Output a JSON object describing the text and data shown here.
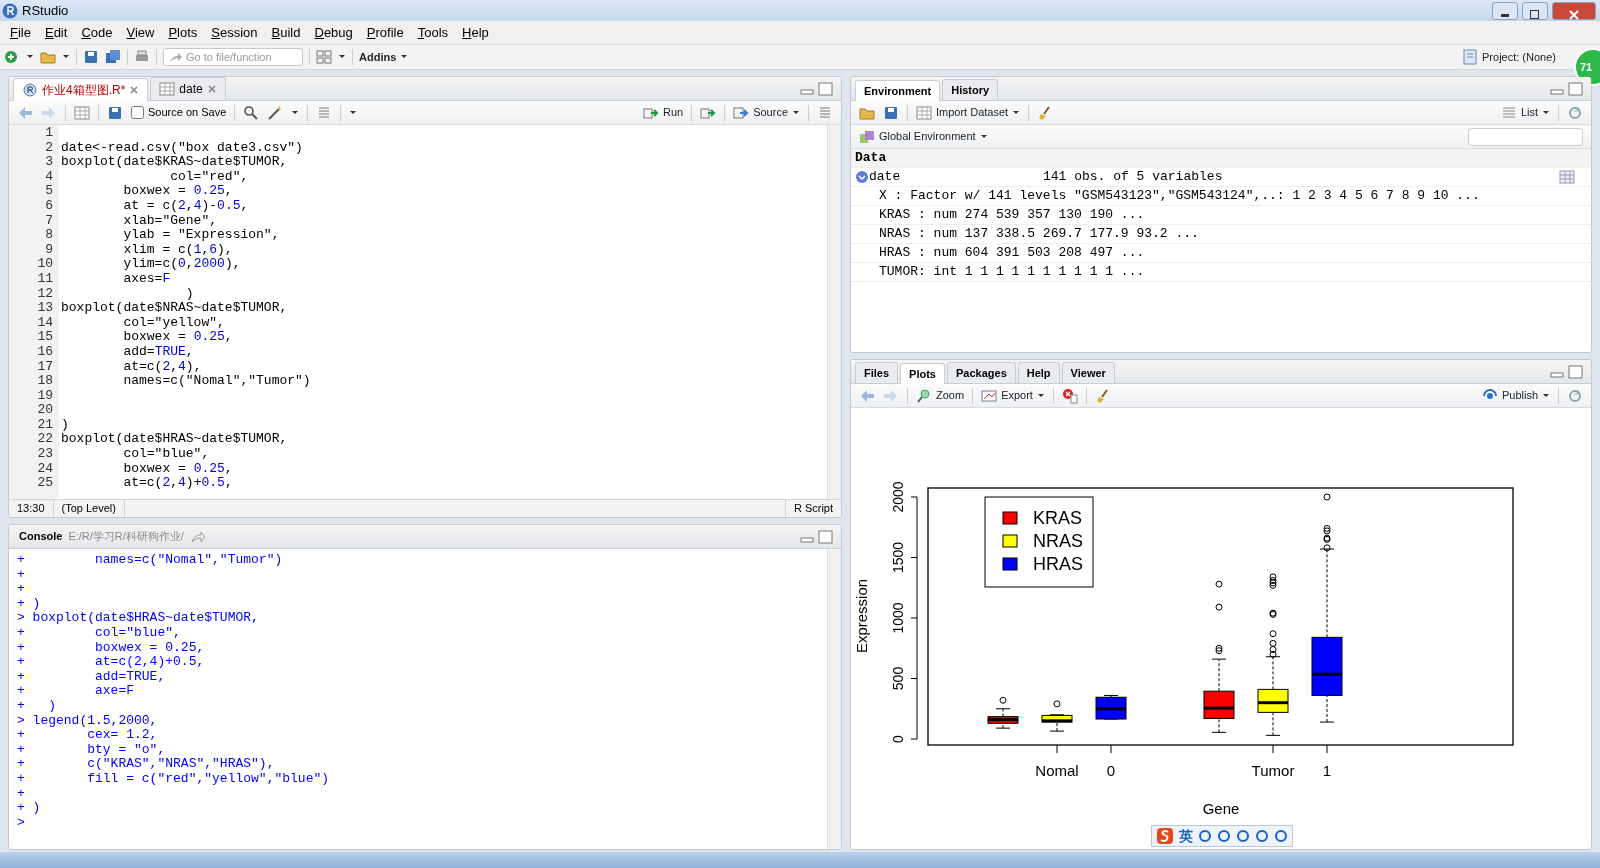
{
  "window": {
    "title": "RStudio"
  },
  "menu": [
    "File",
    "Edit",
    "Code",
    "View",
    "Plots",
    "Session",
    "Build",
    "Debug",
    "Profile",
    "Tools",
    "Help"
  ],
  "toolbar": {
    "goto_placeholder": "Go to file/function",
    "addins": "Addins",
    "project": "Project: (None)"
  },
  "notification_badge": "71",
  "editor": {
    "tabs": [
      {
        "label": "作业4箱型图.R*",
        "kind": "script",
        "unsaved": true,
        "selected": true
      },
      {
        "label": "date",
        "kind": "data",
        "unsaved": false,
        "selected": false
      }
    ],
    "source_on_save": {
      "label": "Source on Save",
      "checked": false
    },
    "run_label": "Run",
    "source_label": "Source",
    "lines": [
      {
        "number": "1"
      },
      {
        "number": "2",
        "text": "date<-read.csv(\"box date3.csv\")"
      },
      {
        "number": "3",
        "text": "boxplot(date$KRAS~date$TUMOR,"
      },
      {
        "number": "4",
        "text": "              col=\"red\","
      },
      {
        "number": "5",
        "text": "        boxwex = 0.25,"
      },
      {
        "number": "6",
        "text": "        at = c(2,4)-0.5,"
      },
      {
        "number": "7",
        "text": "        xlab=\"Gene\","
      },
      {
        "number": "8",
        "text": "        ylab = \"Expression\","
      },
      {
        "number": "9",
        "text": "        xlim = c(1,6),"
      },
      {
        "number": "10",
        "text": "        ylim=c(0,2000),"
      },
      {
        "number": "11",
        "text": "        axes=F"
      },
      {
        "number": "12",
        "text": "                )"
      },
      {
        "number": "13",
        "text": "boxplot(date$NRAS~date$TUMOR,"
      },
      {
        "number": "14",
        "text": "        col=\"yellow\","
      },
      {
        "number": "15",
        "text": "        boxwex = 0.25,"
      },
      {
        "number": "16",
        "text": "        add=TRUE,"
      },
      {
        "number": "17",
        "text": "        at=c(2,4),"
      },
      {
        "number": "18",
        "text": "        names=c(\"Nomal\",\"Tumor\")"
      },
      {
        "number": "19"
      },
      {
        "number": "20"
      },
      {
        "number": "21",
        "text": ")"
      },
      {
        "number": "22",
        "text": "boxplot(date$HRAS~date$TUMOR,"
      },
      {
        "number": "23",
        "text": "        col=\"blue\","
      },
      {
        "number": "24",
        "text": "        boxwex = 0.25,"
      },
      {
        "number": "25",
        "text": "        at=c(2,4)+0.5,"
      }
    ],
    "status": {
      "position": "13:30",
      "scope": "(Top Level)",
      "file_type": "R Script"
    }
  },
  "console": {
    "title": "Console",
    "path": "E:/R/学习R/科研狗作业/",
    "lines": [
      {
        "prompt": "+",
        "text": "        names=c(\"Nomal\",\"Tumor\")"
      },
      {
        "prompt": "+"
      },
      {
        "prompt": "+"
      },
      {
        "prompt": "+",
        "text": ")"
      },
      {
        "prompt": ">",
        "text": "boxplot(date$HRAS~date$TUMOR,"
      },
      {
        "prompt": "+",
        "text": "        col=\"blue\","
      },
      {
        "prompt": "+",
        "text": "        boxwex = 0.25,"
      },
      {
        "prompt": "+",
        "text": "        at=c(2,4)+0.5,"
      },
      {
        "prompt": "+",
        "text": "        add=TRUE,"
      },
      {
        "prompt": "+",
        "text": "        axe=F"
      },
      {
        "prompt": "+",
        "text": "  )"
      },
      {
        "prompt": ">",
        "text": "legend(1.5,2000,"
      },
      {
        "prompt": "+",
        "text": "       cex= 1.2,"
      },
      {
        "prompt": "+",
        "text": "       bty = \"o\","
      },
      {
        "prompt": "+",
        "text": "       c(\"KRAS\",\"NRAS\",\"HRAS\"),"
      },
      {
        "prompt": "+",
        "text": "       fill = c(\"red\",\"yellow\",\"blue\")"
      },
      {
        "prompt": "+"
      },
      {
        "prompt": "+",
        "text": ")"
      },
      {
        "prompt": ">"
      }
    ]
  },
  "environment": {
    "tabs": [
      {
        "label": "Environment",
        "selected": true
      },
      {
        "label": "History",
        "selected": false
      }
    ],
    "import_label": "Import Dataset",
    "view_label": "List",
    "scope_label": "Global Environment",
    "section": "Data",
    "objects": [
      {
        "name": "date",
        "summary": "141 obs. of 5 variables",
        "expanded": true,
        "children": [
          "X : Factor w/ 141 levels \"GSM543123\",\"GSM543124\",..: 1 2 3 4 5 6 7 8 9 10 ...",
          "KRAS : num 274 539 357 130 190 ...",
          "NRAS : num 137 338.5 269.7 177.9 93.2 ...",
          "HRAS : num 604 391 503 208 497 ...",
          "TUMOR: int 1 1 1 1 1 1 1 1 1 1 ..."
        ]
      }
    ]
  },
  "plots_pane": {
    "tabs": [
      {
        "label": "Files",
        "selected": false
      },
      {
        "label": "Plots",
        "selected": true
      },
      {
        "label": "Packages",
        "selected": false
      },
      {
        "label": "Help",
        "selected": false
      },
      {
        "label": "Viewer",
        "selected": false
      }
    ],
    "zoom_label": "Zoom",
    "export_label": "Export",
    "publish_label": "Publish",
    "plot": {
      "xlabel": "Gene",
      "ylabel": "Expression",
      "yticks": [
        "0",
        "500",
        "1000",
        "1500",
        "2000"
      ],
      "xtick_labels": [
        "Nomal",
        "0",
        "Tumor",
        "1"
      ],
      "legend": [
        {
          "label": "KRAS",
          "color": "#ff0000"
        },
        {
          "label": "NRAS",
          "color": "#ffff00"
        },
        {
          "label": "HRAS",
          "color": "#0000ff"
        }
      ]
    }
  },
  "ime_bar": {
    "label": "英"
  }
}
